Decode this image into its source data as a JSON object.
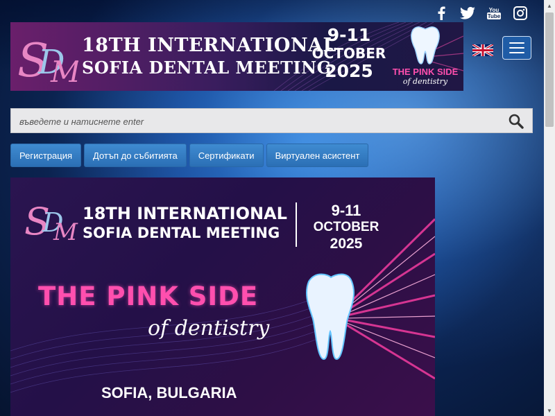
{
  "social": {
    "facebook": "facebook-icon",
    "twitter": "twitter-icon",
    "youtube": "youtube-icon",
    "instagram": "instagram-icon"
  },
  "banner": {
    "title_line1": "18TH INTERNATIONAL",
    "title_line2": "SOFIA DENTAL MEETING",
    "date_days": "9-11",
    "date_month": "OCTOBER",
    "date_year": "2025",
    "slogan_pink": "THE PINK SIDE",
    "slogan_sub": "of dentistry",
    "logo_text": "SDM"
  },
  "language": {
    "flag": "uk-flag-icon"
  },
  "search": {
    "placeholder": "въведете и натиснете enter"
  },
  "nav": {
    "items": [
      {
        "label": "Регистрация"
      },
      {
        "label": "Дотъп до събитията"
      },
      {
        "label": "Сертификати"
      },
      {
        "label": "Виртуален асистент"
      }
    ]
  },
  "hero": {
    "title_line1": "18TH INTERNATIONAL",
    "title_line2": "SOFIA DENTAL MEETING",
    "date_days": "9-11",
    "date_month": "OCTOBER",
    "date_year": "2025",
    "headline": "THE PINK SIDE",
    "subline": "of dentistry",
    "location": "SOFIA, BULGARIA"
  },
  "colors": {
    "accent_pink": "#ff4fae",
    "nav_blue": "#2b6fb5",
    "banner_purple": "#3a1d5e"
  }
}
